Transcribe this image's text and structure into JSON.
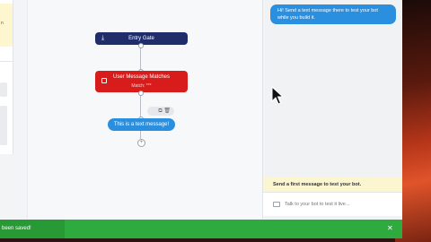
{
  "left_panel": {
    "notice_text": "n"
  },
  "canvas": {
    "entry_node": {
      "label": "Entry Gate",
      "icon": "download-icon"
    },
    "match_node": {
      "label": "User Message Matches",
      "sub_label": "Match: ***",
      "icon": "calendar-icon"
    },
    "message_node": {
      "label": "This is a text message!"
    },
    "toolbar": {
      "icons": [
        "copy-icon",
        "trash-icon"
      ],
      "glyphs": "⧉ 🗑"
    },
    "add_glyph": "+"
  },
  "simulator": {
    "bot_message": "Hi! Send a text message there to test your bot while you build it.",
    "prompt": "Send a first message to test your bot.",
    "input_placeholder": "Talk to your bot to test it live..."
  },
  "toast": {
    "message": "been saved!",
    "close_glyph": "✕"
  },
  "colors": {
    "entry_node": "#1f2d6b",
    "match_node": "#d81b1b",
    "message_node": "#2b8fe0",
    "toast": "#2faa3f",
    "prompt_bg": "#fbf6cf"
  }
}
